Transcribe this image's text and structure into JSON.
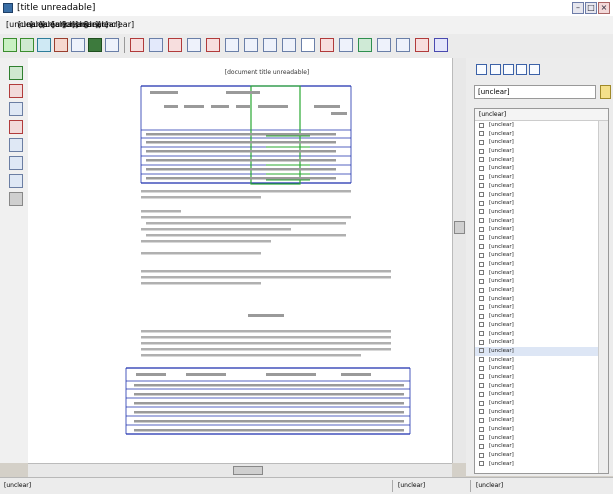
{
  "window": {
    "title": "[title unreadable]",
    "controls": [
      "–",
      "□",
      "×"
    ]
  },
  "menu": {
    "items": [
      "[unclear]",
      "[unclear]",
      "[unclear]",
      "[unclear]",
      "[unclear]",
      "[unclear]",
      "[unclear]",
      "[unclear]",
      "[unclear]"
    ]
  },
  "document": {
    "title": "[document title unreadable]"
  },
  "right_panel": {
    "search_value": "[unclear]",
    "list_header": "[unclear]",
    "items": [
      "[unclear]",
      "[unclear]",
      "[unclear]",
      "[unclear]",
      "[unclear]",
      "[unclear]",
      "[unclear]",
      "[unclear]",
      "[unclear]",
      "[unclear]",
      "[unclear]",
      "[unclear]",
      "[unclear]",
      "[unclear]",
      "[unclear]",
      "[unclear]",
      "[unclear]",
      "[unclear]",
      "[unclear]",
      "[unclear]",
      "[unclear]",
      "[unclear]",
      "[unclear]",
      "[unclear]",
      "[unclear]",
      "[unclear]",
      "[unclear]",
      "[unclear]",
      "[unclear]",
      "[unclear]",
      "[unclear]",
      "[unclear]",
      "[unclear]",
      "[unclear]",
      "[unclear]",
      "[unclear]",
      "[unclear]",
      "[unclear]",
      "[unclear]",
      "[unclear]"
    ],
    "selected_index": 26
  },
  "status": {
    "left": "[unclear]",
    "middle": "[unclear]",
    "right": "[unclear]"
  },
  "colors": {
    "accent": "#3a6ea5",
    "selection": "#dde6f5",
    "table_rule": "#1c2fae",
    "highlight_box": "#2aa832"
  }
}
